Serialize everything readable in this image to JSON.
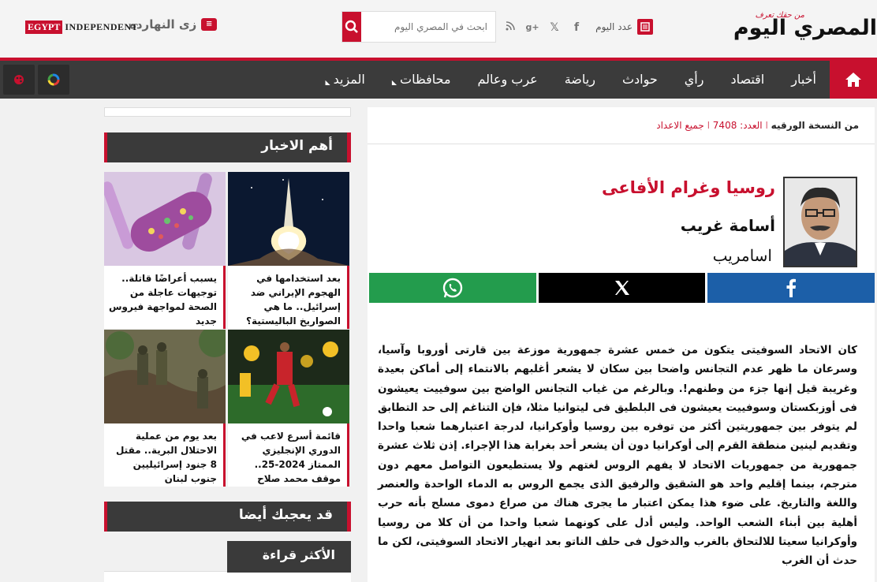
{
  "header": {
    "logo_slogan": "من حقك تعرف",
    "logo_text": "المصري اليوم",
    "issue_label": "عدد اليوم",
    "search_placeholder": "ابحث في المصري اليوم",
    "zy_label": "زى النهارده",
    "egypt_part": "EGYPT",
    "independent_part": "INDEPENDENT",
    "social_icons": [
      "facebook-icon",
      "x-icon",
      "google-plus-icon",
      "rss-icon"
    ]
  },
  "nav": {
    "items": [
      {
        "label": "أخبار"
      },
      {
        "label": "اقتصاد"
      },
      {
        "label": "رأي"
      },
      {
        "label": "حوادث"
      },
      {
        "label": "رياضة"
      },
      {
        "label": "عرب وعالم"
      },
      {
        "label": "محافظات",
        "dropdown": true
      },
      {
        "label": "المزيد",
        "dropdown": true
      }
    ]
  },
  "article": {
    "crumb_source": "من النسخة الورقيه",
    "crumb_issue": "العدد: 7408",
    "crumb_all": "جميع الاعداد",
    "title": "روسيا وغرام الأفاعى",
    "author": "أسامة غريب",
    "signature": "اسامريب",
    "body": "كان الاتحاد السوفيتى يتكون من خمس عشرة جمهورية موزعة بين قارتى أوروبا وآسيا، وسرعان ما ظهر عدم التجانس واضحا بين سكان لا يشعر أغلبهم بالانتماء إلى أماكن بعيدة وغريبة قيل إنها جزء من وطنهم!. وبالرغم من غياب التجانس الواضح بين سوفييت يعيشون فى أوزبكستان وسوفييت يعيشون فى البلطيق فى ليتوانيا مثلا، فإن التناغم إلى حد التطابق لم يتوفر بين جمهوريتين أكثر من توفره بين روسيا وأوكرانيا، لدرجة اعتبارهما شعبا واحدا وتقديم لينين منطقة القرم إلى أوكرانيا دون أن يشعر أحد بغرابة هذا الإجراء. إذن ثلاث عشرة جمهورية من جمهوريات الاتحاد لا يفهم الروس لغتهم ولا يستطيعون التواصل معهم دون مترجم، بينما إقليم واحد هو الشقيق والرفيق الذى يجمع الروس به الدماء الواحدة والعنصر واللغة والتاريخ. على ضوء هذا يمكن اعتبار ما يجرى هناك من صراع دموى مسلح بأنه حرب أهلية بين أبناء الشعب الواحد. وليس أدل على كونهما شعبا واحدا من أن كلا من روسيا وأوكرانيا سعيتا للالتحاق بالغرب والدخول فى حلف الناتو بعد انهيار الاتحاد السوفيتى، لكن ما حدث أن الغرب"
  },
  "sidebar": {
    "top_news_title": "أهم الاخبار",
    "cards": [
      {
        "caption": "بعد استخدامها في الهجوم الإيراني ضد إسرائيل.. ما هي الصواريخ الباليستية؟"
      },
      {
        "caption": "يسبب أعراضًا قاتلة.. توجيهات عاجلة من الصحة لمواجهة فيروس جديد"
      },
      {
        "caption": "قائمة أسرع لاعب في الدوري الإنجليزي الممتاز 2024-25.. موقف محمد صلاح"
      },
      {
        "caption": "بعد يوم من عملية الاحتلال البرية.. مقتل 8 جنود إسرائيليين جنوب لبنان"
      }
    ],
    "also_like_title": "قد يعجبك أيضا",
    "most_read_title": "الأكثر قراءة"
  },
  "colors": {
    "brand_red": "#c8102e",
    "nav_dark": "#3b3b3b",
    "facebook": "#1c5fa8",
    "x": "#000000",
    "whatsapp": "#239c4d"
  }
}
